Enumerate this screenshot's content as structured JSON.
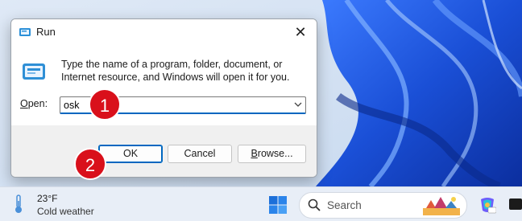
{
  "dialog": {
    "title": "Run",
    "close_glyph": "✕",
    "description": "Type the name of a program, folder, document, or Internet resource, and Windows will open it for you.",
    "open_label_underline": "O",
    "open_label_rest": "pen:",
    "input_value": "osk",
    "buttons": {
      "ok": "OK",
      "cancel": "Cancel",
      "browse_underline": "B",
      "browse_rest": "rowse..."
    }
  },
  "badges": {
    "step1": "1",
    "step2": "2"
  },
  "taskbar": {
    "weather": {
      "temperature": "23°F",
      "condition": "Cold weather"
    },
    "search": {
      "placeholder": "Search"
    }
  },
  "icons": {
    "app": "run-icon",
    "close": "close-icon",
    "dropdown": "chevron-down-icon",
    "weather": "thermometer-icon",
    "start": "windows-start-icon",
    "search": "search-icon",
    "copilot": "copilot-icon"
  },
  "colors": {
    "accent": "#0067c0",
    "badge": "#d9101b",
    "wallpaper": "#1a4fd6"
  }
}
